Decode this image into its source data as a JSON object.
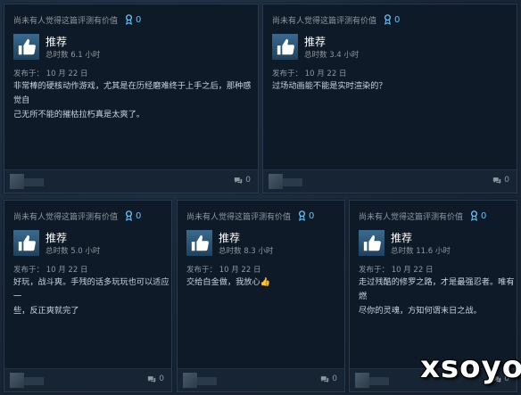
{
  "reviews": [
    {
      "helpful": "尚未有人觉得这篇评测有价值",
      "awards": "0",
      "title": "推荐",
      "hours": "总时数 6.1 小时",
      "posted": "发布于：  10 月 22 日",
      "text": [
        "非常棒的硬核动作游戏，尤其是在历经磨难终于上手之后，那种感觉自",
        "己无所不能的摧枯拉朽真是太爽了。"
      ],
      "comments": "0"
    },
    {
      "helpful": "尚未有人觉得这篇评测有价值",
      "awards": "0",
      "title": "推荐",
      "hours": "总时数 3.4 小时",
      "posted": "发布于：  10 月 22 日",
      "text": [
        "过场动画能不能是实时渲染的？"
      ],
      "comments": "0"
    },
    {
      "helpful": "尚未有人觉得这篇评测有价值",
      "awards": "0",
      "title": "推荐",
      "hours": "总时数 5.0 小时",
      "posted": "发布于：  10 月 22 日",
      "text": [
        "好玩，战斗爽。手残的话多玩玩也可以适应一",
        "些，反正爽就完了"
      ],
      "comments": "0"
    },
    {
      "helpful": "尚未有人觉得这篇评测有价值",
      "awards": "0",
      "title": "推荐",
      "hours": "总时数 8.3 小时",
      "posted": "发布于：  10 月 22 日",
      "text": [
        "交给白金做，我放心👍"
      ],
      "comments": "0"
    },
    {
      "helpful": "尚未有人觉得这篇评测有价值",
      "awards": "0",
      "title": "推荐",
      "hours": "总时数 11.6 小时",
      "posted": "发布于：  10 月 22 日",
      "text": [
        "走过残酷的修罗之路，才是最强忍者。唯有燃",
        "尽你的灵魂，方知何谓末日之战。"
      ],
      "comments": "0"
    }
  ],
  "watermark": "xsoyo",
  "icons": {
    "award": "award-ribbon-icon",
    "recommend": "thumbs-up-icon",
    "comment": "comment-bubble-icon"
  },
  "colors": {
    "accent": "#66c0f4",
    "card_bg": "#0f1a28",
    "page_bg": "#1b2838"
  }
}
